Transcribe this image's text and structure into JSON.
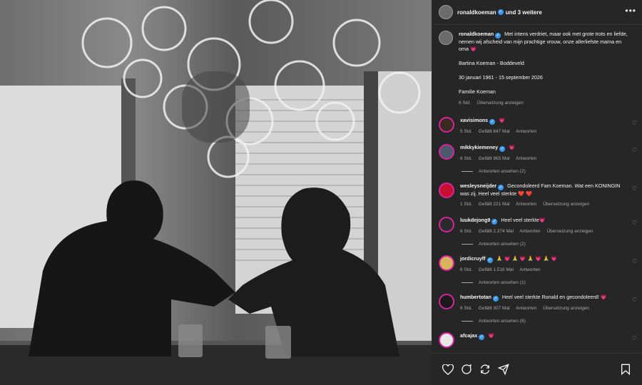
{
  "header": {
    "username": "ronaldkoeman",
    "extra": "und 3 weitere",
    "more_label": "•••"
  },
  "caption": {
    "username": "ronaldkoeman",
    "text": "Met intens verdriet, maar ook met grote trots en liefde, nemen wij afscheid van mijn prachtige vrouw, onze allerliefste mama en oma",
    "emoji": "💗",
    "name_line": "Bartina Koeman - Boddeveld",
    "dates": "30 januari 1961 - 15 september 2026",
    "family": "Familie Koeman",
    "time": "6 Std.",
    "translate": "Übersetzung anzeigen"
  },
  "comments": [
    {
      "username": "xavisimons",
      "text": "💗",
      "time": "5 Std.",
      "likes": "Gefällt 847 Mal",
      "reply": "Antworten",
      "translate": "",
      "replies": "",
      "avatar_color": "#3a2a1f"
    },
    {
      "username": "mikkykiemeney",
      "text": "💗",
      "time": "6 Std.",
      "likes": "Gefällt 965 Mal",
      "reply": "Antworten",
      "translate": "",
      "replies": "Antworten ansehen (2)",
      "avatar_color": "#4a5a6a"
    },
    {
      "username": "wesleysneijder",
      "text": "Gecondoleerd Fam Koeman. Wat een KONINGIN was zij. Heel veel sterkte ❤️ ❤️",
      "time": "1 Std.",
      "likes": "Gefällt 221 Mal",
      "reply": "Antworten",
      "translate": "Übersetzung anzeigen",
      "replies": "",
      "avatar_color": "#c8102e"
    },
    {
      "username": "luukdejong9",
      "text": "Heel veel sterkte💗",
      "time": "6 Std.",
      "likes": "Gefällt 2.374 Mal",
      "reply": "Antworten",
      "translate": "Übersetzung anzeigen",
      "replies": "Antworten ansehen (2)",
      "avatar_color": "#2a2a2a"
    },
    {
      "username": "jordicruyff",
      "text": "🙏 💗 🙏 💗 🙏 💗 🙏 💗",
      "time": "6 Std.",
      "likes": "Gefällt 1.516 Mal",
      "reply": "Antworten",
      "translate": "",
      "replies": "Antworten ansehen (1)",
      "avatar_color": "#d8b45a"
    },
    {
      "username": "humbertotan",
      "text": "Heel veel sterkte Ronald en gecondoleerd! 💗",
      "time": "6 Std.",
      "likes": "Gefällt 307 Mal",
      "reply": "Antworten",
      "translate": "Übersetzung anzeigen",
      "replies": "Antworten ansehen (6)",
      "avatar_color": "#1a1a1a"
    },
    {
      "username": "afcajax",
      "text": "💗",
      "time": "",
      "likes": "",
      "reply": "",
      "translate": "",
      "replies": "",
      "avatar_color": "#e8e8e8"
    }
  ],
  "colors": {
    "panel_bg": "#262626",
    "verified": "#3897f0",
    "muted": "#a8a8a8",
    "heart": "#ff3040"
  },
  "icons": {
    "footer": [
      "heart-icon",
      "comment-icon",
      "repost-icon",
      "share-icon",
      "bookmark-icon"
    ]
  }
}
